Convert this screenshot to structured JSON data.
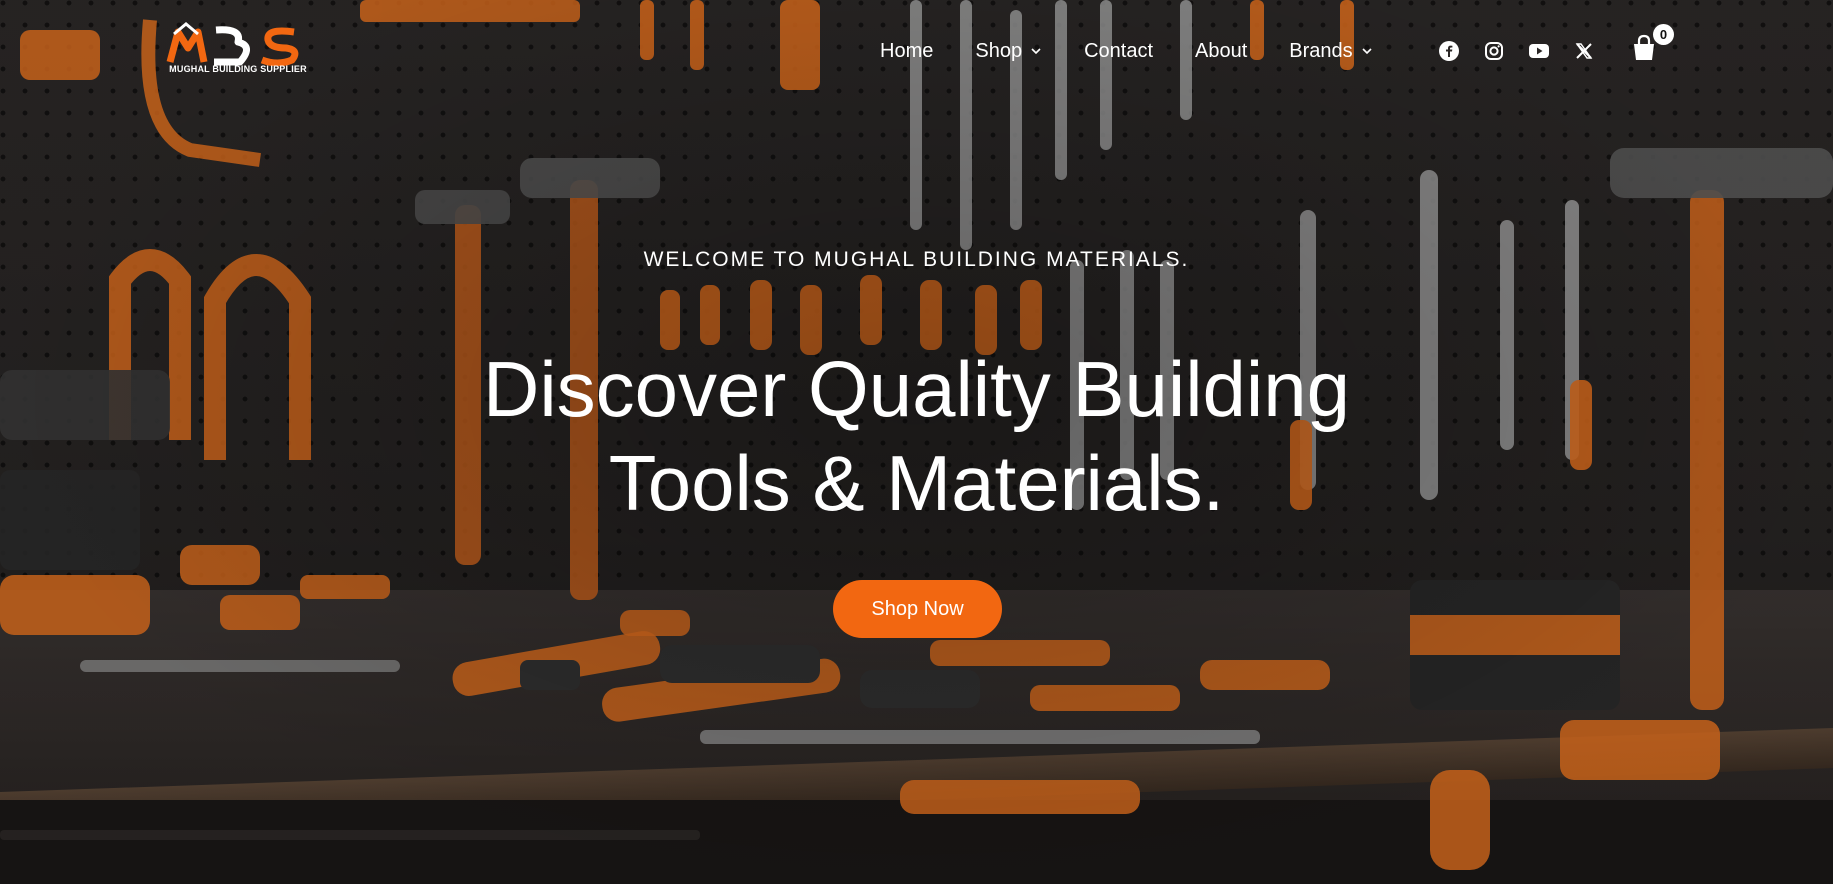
{
  "brand": {
    "logo_mark": "MBS",
    "logo_subtitle": "MUGHAL BUILDING SUPPLIER",
    "accent_color": "#f26711"
  },
  "nav": {
    "items": [
      {
        "label": "Home",
        "has_dropdown": false
      },
      {
        "label": "Shop",
        "has_dropdown": true
      },
      {
        "label": "Contact",
        "has_dropdown": false
      },
      {
        "label": "About",
        "has_dropdown": false
      },
      {
        "label": "Brands",
        "has_dropdown": true
      }
    ]
  },
  "social": [
    "facebook-icon",
    "instagram-icon",
    "youtube-icon",
    "x-twitter-icon"
  ],
  "cart": {
    "count": "0",
    "icon": "shopping-bag-icon"
  },
  "hero": {
    "eyebrow": "WELCOME TO MUGHAL BUILDING MATERIALS.",
    "headline_line1": "Discover Quality Building",
    "headline_line2": "Tools & Materials.",
    "cta_label": "Shop Now"
  }
}
